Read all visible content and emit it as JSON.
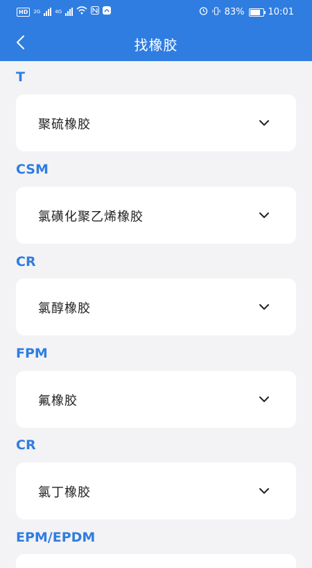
{
  "status_bar": {
    "left_tag": "HD",
    "network_1": "2G",
    "network_2": "4G",
    "battery_percent": "83%",
    "time": "10:01"
  },
  "navbar": {
    "title": "找橡胶",
    "back_icon": "chevron-left-icon"
  },
  "groups": [
    {
      "code": "T",
      "name": "聚硫橡胶"
    },
    {
      "code": "CSM",
      "name": "氯磺化聚乙烯橡胶"
    },
    {
      "code": "CR",
      "name": "氯醇橡胶"
    },
    {
      "code": "FPM",
      "name": "氟橡胶"
    },
    {
      "code": "CR",
      "name": "氯丁橡胶"
    },
    {
      "code": "EPM/EPDM",
      "name": ""
    }
  ],
  "colors": {
    "accent": "#2f7de1",
    "background": "#f3f3f5",
    "card": "#ffffff"
  }
}
